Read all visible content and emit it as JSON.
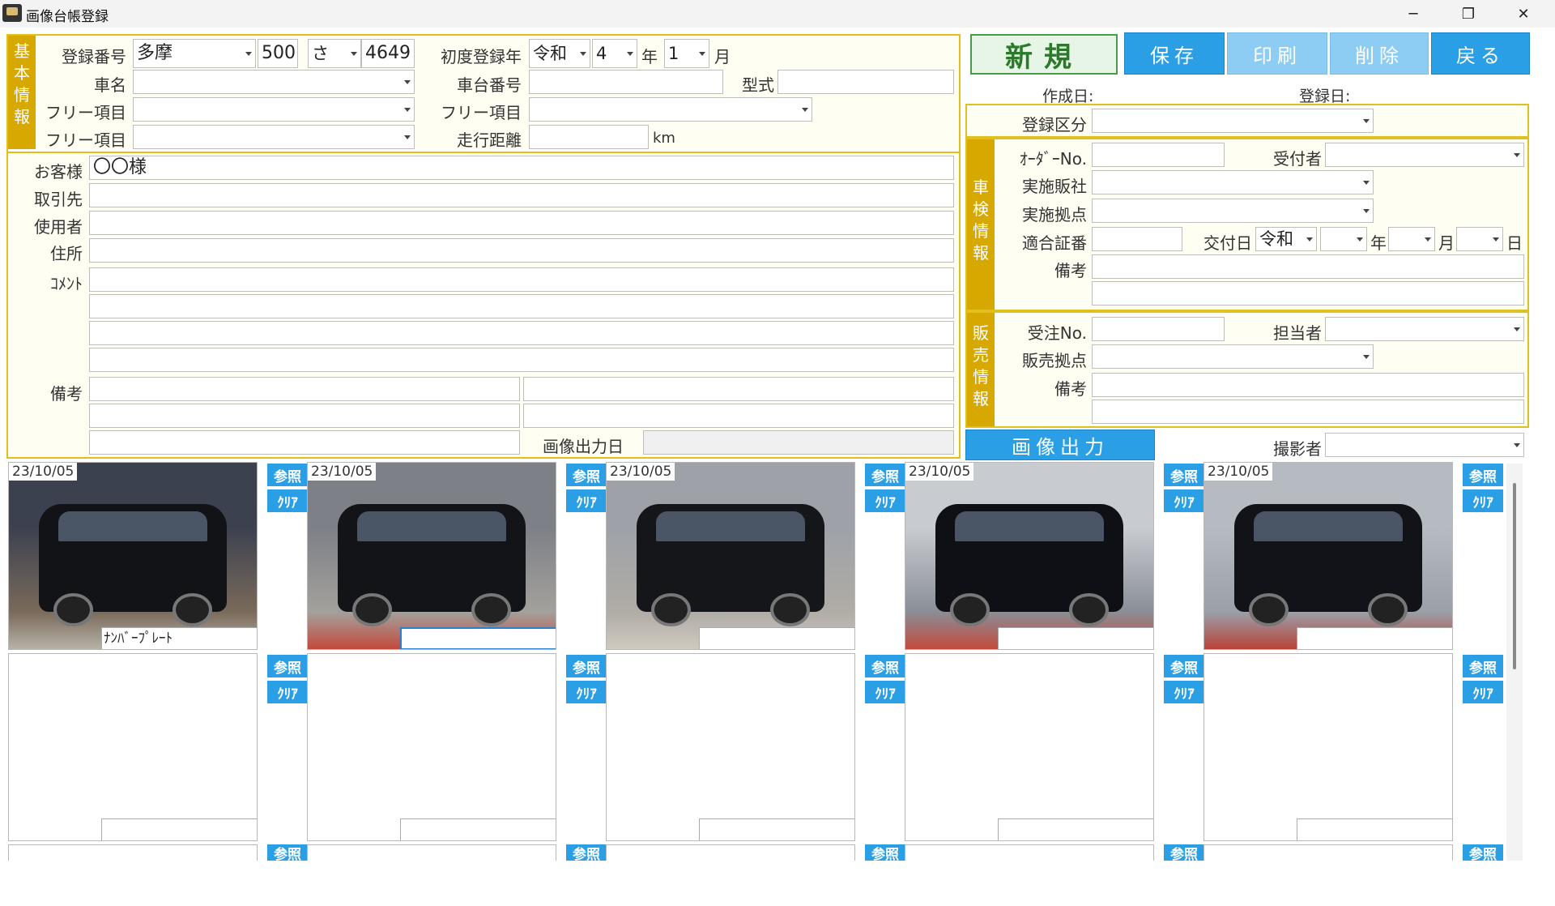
{
  "window": {
    "title": "画像台帳登録"
  },
  "basic": {
    "section_label": "基本情報",
    "reg_number_label": "登録番号",
    "reg_area": "多摩",
    "reg_class": "500",
    "reg_kana": "さ",
    "reg_serial": "4649",
    "first_reg_label": "初度登録年",
    "era": "令和",
    "year_value": "4",
    "year_label": "年",
    "month_value": "1",
    "month_label": "月",
    "car_name_label": "車名",
    "chassis_label": "車台番号",
    "model_label": "型式",
    "free1_label": "フリー項目",
    "free2_label": "フリー項目",
    "free3_label": "フリー項目",
    "mileage_label": "走行距離",
    "mileage_unit": "km",
    "customer_label": "お客様",
    "customer_value": "〇〇様",
    "client_label": "取引先",
    "user_label": "使用者",
    "address_label": "住所",
    "comment_label": "ｺﾒﾝﾄ",
    "notes_label": "備考",
    "image_output_date_label": "画像出力日"
  },
  "toolbar": {
    "new": "新規",
    "save": "保存",
    "print": "印刷",
    "delete": "削除",
    "back": "戻る"
  },
  "meta": {
    "created_label": "作成日:",
    "registered_label": "登録日:",
    "reg_type_label": "登録区分"
  },
  "inspection": {
    "section_label": "車検情報",
    "order_no_label": "ｵｰﾀﾞｰNo.",
    "receptionist_label": "受付者",
    "company_label": "実施販社",
    "base_label": "実施拠点",
    "cert_label": "適合証番",
    "issue_label": "交付日",
    "issue_era": "令和",
    "year_label": "年",
    "month_label": "月",
    "day_label": "日",
    "notes_label": "備考"
  },
  "sales": {
    "section_label": "販売情報",
    "order_no_label": "受注No.",
    "staff_label": "担当者",
    "base_label": "販売拠点",
    "notes_label": "備考"
  },
  "image_output": {
    "button": "画像出力",
    "photographer_label": "撮影者"
  },
  "photo_buttons": {
    "ref": "参照",
    "clear": "ｸﾘｱ"
  },
  "photos": [
    {
      "date": "23/10/05",
      "caption": "ﾅﾝﾊﾞｰﾌﾟﾚｰﾄ"
    },
    {
      "date": "23/10/05",
      "caption": ""
    },
    {
      "date": "23/10/05",
      "caption": ""
    },
    {
      "date": "23/10/05",
      "caption": ""
    },
    {
      "date": "23/10/05",
      "caption": ""
    }
  ],
  "colors": {
    "accent_gold": "#d6a800",
    "button_blue": "#2a9fe6",
    "new_green": "#4a9a4a"
  }
}
